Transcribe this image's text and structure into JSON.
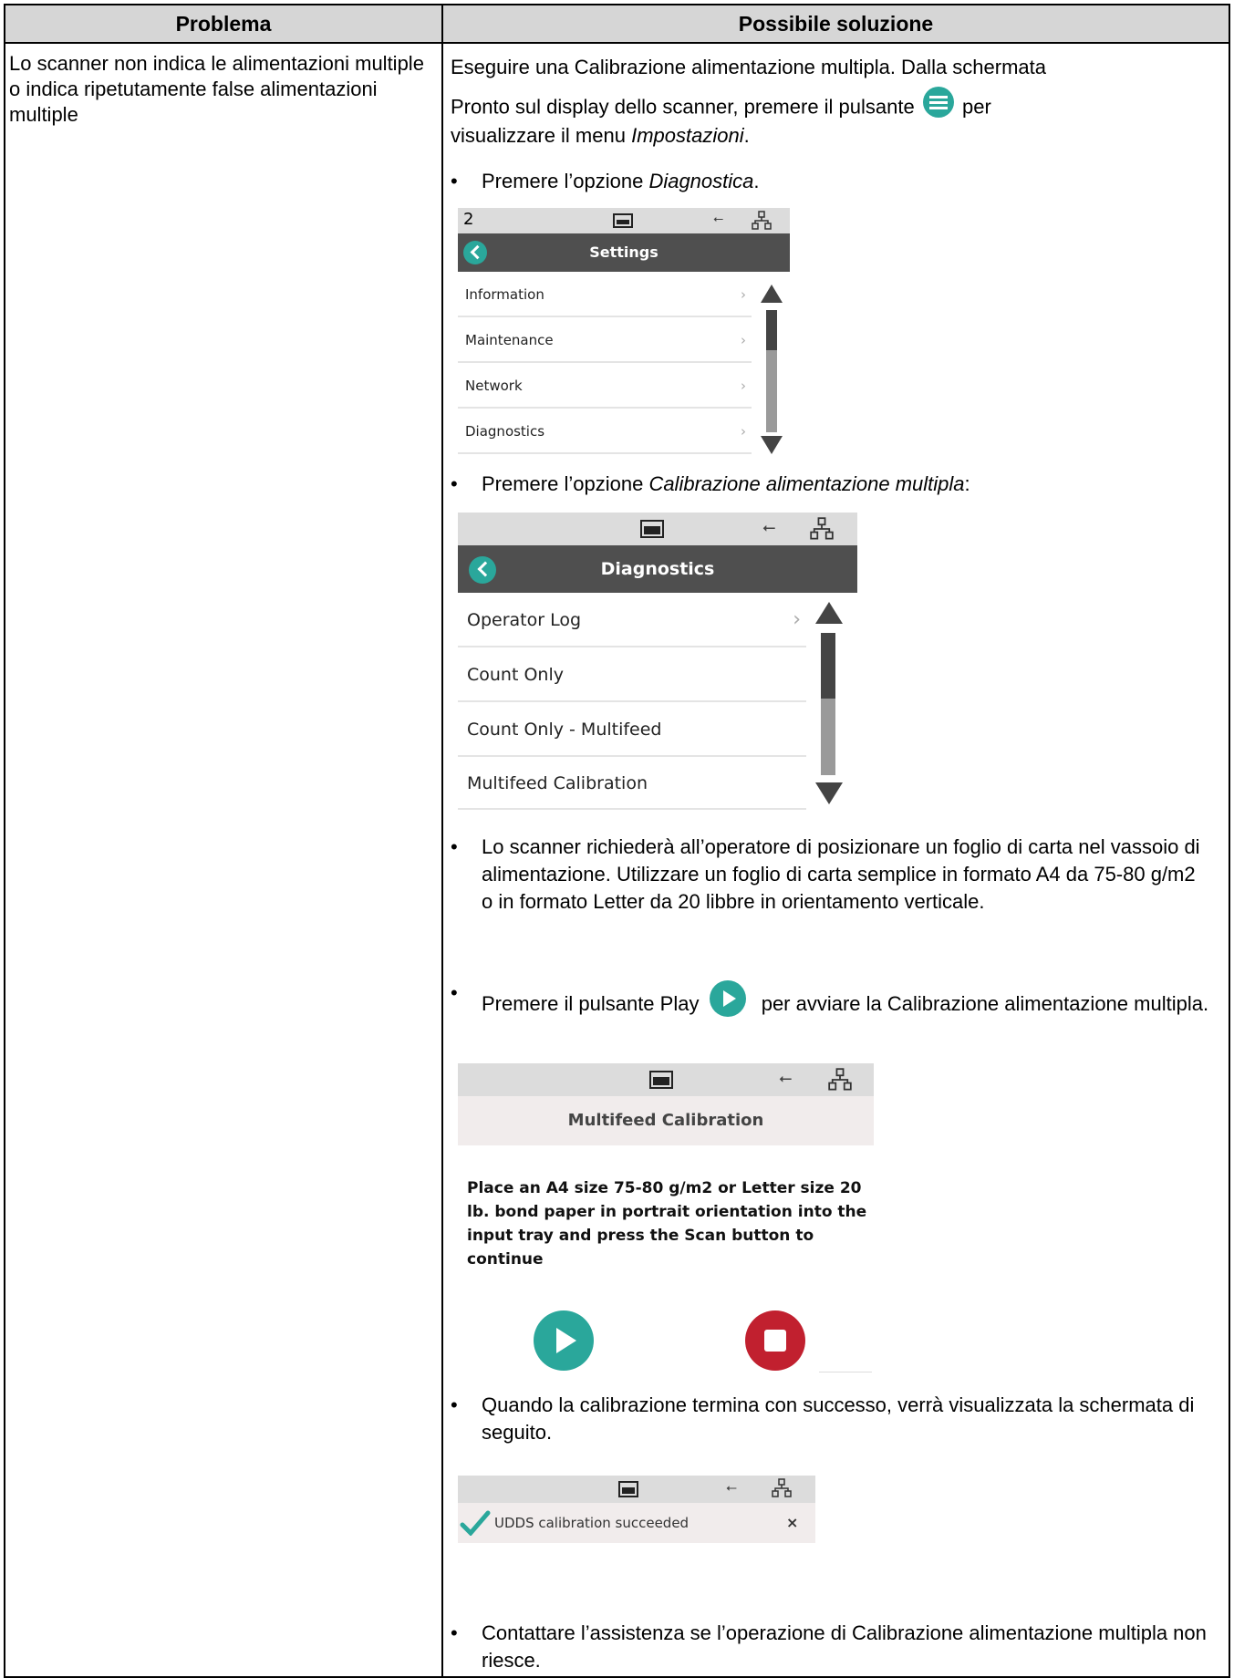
{
  "header": {
    "col1": "Problema",
    "col2": "Possibile soluzione"
  },
  "problem": "Lo scanner non indica le alimentazioni multiple o indica ripetutamente false alimentazioni multiple",
  "solution": {
    "intro_line1": "Eseguire una Calibrazione alimentazione multipla. Dalla schermata",
    "intro_line2_pre": "Pronto sul display dello scanner, premere il pulsante",
    "intro_line2_post": "per",
    "intro_line3_pre": "visualizzare il menu",
    "intro_line3_em": "Impostazioni",
    "intro_line3_post": ".",
    "step1_pre": "Premere l’opzione",
    "step1_em": "Diagnostica",
    "step1_post": ".",
    "step2_pre": "Premere l’opzione",
    "step2_em": "Calibrazione alimentazione multipla",
    "step2_post": ":",
    "step3": "Lo scanner richiederà all’operatore di posizionare un foglio di carta nel vassoio di alimentazione. Utilizzare un foglio di carta semplice in formato A4 da 75-80 g/m2 o in formato Letter da 20 libbre in orientamento verticale.",
    "step4_pre": "Premere il pulsante Play",
    "step4_post": "per avviare la Calibrazione alimentazione multipla.",
    "step5": "Quando la calibrazione termina con successo, verrà visualizzata la schermata di seguito.",
    "step6": "Contattare l’assistenza se l’operazione di Calibrazione alimentazione multipla non riesce.",
    "bullet": "•"
  },
  "screen_settings": {
    "status_number": "2",
    "title": "Settings",
    "items": [
      "Information",
      "Maintenance",
      "Network",
      "Diagnostics"
    ]
  },
  "screen_diagnostics": {
    "title": "Diagnostics",
    "items": [
      "Operator Log",
      "Count Only",
      "Count Only - Multifeed",
      "Multifeed Calibration"
    ]
  },
  "screen_calibration": {
    "title": "Multifeed Calibration",
    "message": "Place an A4 size 75-80 g/m2 or Letter size 20 lb. bond paper in portrait orientation into the input tray and press the Scan button to continue"
  },
  "screen_success": {
    "message": "UDDS calibration succeeded",
    "close": "×"
  },
  "icons": {
    "menu": "menu-icon",
    "play": "play-icon",
    "stop": "stop-icon",
    "usb": "usb-icon",
    "network": "network-icon",
    "printer": "scanner-icon",
    "check": "check-icon",
    "back": "back-icon"
  },
  "colors": {
    "accent_teal": "#2aa79b",
    "stop_red": "#c1202f",
    "title_bar": "#4f4f4f",
    "header_bg": "#d6d6d6"
  }
}
